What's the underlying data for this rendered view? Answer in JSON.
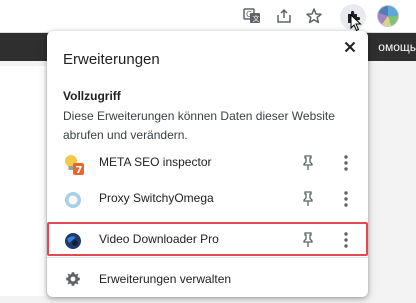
{
  "toolbar": {
    "icons": [
      "translate-icon",
      "share-icon",
      "bookmark-star-icon",
      "extensions-puzzle-icon",
      "profile-avatar"
    ]
  },
  "page_behind": {
    "right_text": "омощь"
  },
  "extensions_popup": {
    "title": "Erweiterungen",
    "close_icon": "close-icon",
    "full_access": {
      "heading": "Vollzugriff",
      "description": "Diese Erweiterungen können Daten dieser Website abrufen und verändern."
    },
    "extensions": [
      {
        "name": "META SEO inspector",
        "icon": "meta-seo-icon",
        "badge": "7"
      },
      {
        "name": "Proxy SwitchyOmega",
        "icon": "proxy-switchyomega-icon"
      },
      {
        "name": "Video Downloader Pro",
        "icon": "video-downloader-icon",
        "highlighted": true
      }
    ],
    "manage_label": "Erweiterungen verwalten",
    "highlight_color": "#e04a52"
  }
}
